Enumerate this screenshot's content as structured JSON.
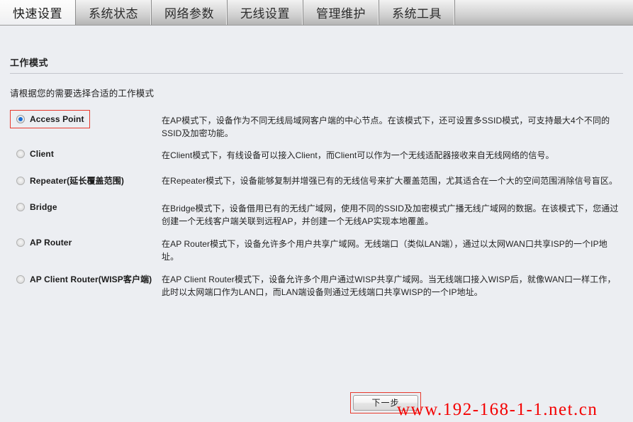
{
  "tabs": [
    {
      "label": "快速设置",
      "active": true
    },
    {
      "label": "系统状态",
      "active": false
    },
    {
      "label": "网络参数",
      "active": false
    },
    {
      "label": "无线设置",
      "active": false
    },
    {
      "label": "管理维护",
      "active": false
    },
    {
      "label": "系统工具",
      "active": false
    }
  ],
  "page": {
    "section_title": "工作模式",
    "intro": "请根据您的需要选择合适的工作模式"
  },
  "modes": [
    {
      "label": "Access Point",
      "selected": true,
      "highlighted": true,
      "description": "在AP模式下，设备作为不同无线局域网客户端的中心节点。在该模式下，还可设置多SSID模式，可支持最大4个不同的SSID及加密功能。"
    },
    {
      "label": "Client",
      "selected": false,
      "highlighted": false,
      "description": "在Client模式下，有线设备可以接入Client，而Client可以作为一个无线适配器接收来自无线网络的信号。"
    },
    {
      "label": "Repeater(延长覆盖范围)",
      "selected": false,
      "highlighted": false,
      "description": "在Repeater模式下，设备能够复制并增强已有的无线信号来扩大覆盖范围，尤其适合在一个大的空间范围消除信号盲区。"
    },
    {
      "label": "Bridge",
      "selected": false,
      "highlighted": false,
      "description": "在Bridge模式下，设备借用已有的无线广域网，使用不同的SSID及加密模式广播无线广域网的数据。在该模式下，您通过创建一个无线客户端关联到远程AP，并创建一个无线AP实现本地覆盖。"
    },
    {
      "label": "AP Router",
      "selected": false,
      "highlighted": false,
      "description": "在AP Router模式下，设备允许多个用户共享广域网。无线端口（类似LAN端），通过以太网WAN口共享ISP的一个IP地址。"
    },
    {
      "label": "AP Client Router(WISP客户端)",
      "selected": false,
      "highlighted": false,
      "description": "在AP Client Router模式下，设备允许多个用户通过WISP共享广域网。当无线端口接入WISP后，就像WAN口一样工作，此时以太网端口作为LAN口，而LAN端设备则通过无线端口共享WISP的一个IP地址。"
    }
  ],
  "footer": {
    "next_button": "下一步",
    "watermark": "www.192-168-1-1.net.cn"
  },
  "colors": {
    "highlight_red": "#e8392c",
    "watermark_red": "#f40000",
    "radio_blue": "#1a6fd4",
    "page_background": "#eceef2"
  }
}
